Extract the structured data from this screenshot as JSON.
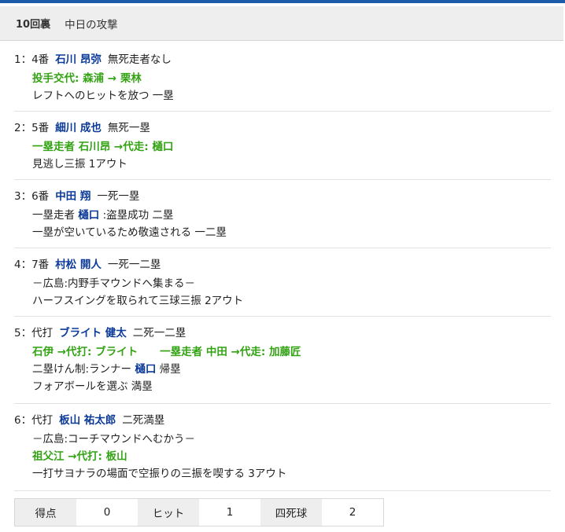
{
  "header": {
    "inning": "10回裏",
    "team_attack": "中日の攻撃"
  },
  "plays": [
    {
      "head": {
        "prefix": "1：4番",
        "batter": "石川 昂弥",
        "situation": "無死走者なし"
      },
      "lines": [
        {
          "segments": [
            {
              "t": "投手交代: ",
              "s": "green"
            },
            {
              "t": "森浦",
              "s": "green"
            },
            {
              "t": " → ",
              "s": "green"
            },
            {
              "t": "栗林",
              "s": "green"
            }
          ]
        },
        {
          "segments": [
            {
              "t": "レフトへのヒットを放つ 一塁",
              "s": ""
            }
          ]
        }
      ]
    },
    {
      "head": {
        "prefix": "2：5番",
        "batter": "細川 成也",
        "situation": "無死一塁"
      },
      "lines": [
        {
          "segments": [
            {
              "t": "一塁走者 ",
              "s": "green"
            },
            {
              "t": "石川昂",
              "s": "green"
            },
            {
              "t": " →代走: ",
              "s": "green"
            },
            {
              "t": "樋口",
              "s": "green"
            }
          ]
        },
        {
          "segments": [
            {
              "t": "見逃し三振 1アウト",
              "s": ""
            }
          ]
        }
      ]
    },
    {
      "head": {
        "prefix": "3：6番",
        "batter": "中田 翔",
        "situation": "一死一塁"
      },
      "lines": [
        {
          "segments": [
            {
              "t": "一塁走者 ",
              "s": ""
            },
            {
              "t": "樋口",
              "s": "blue"
            },
            {
              "t": " :盗塁成功 二塁",
              "s": ""
            }
          ]
        },
        {
          "segments": [
            {
              "t": "一塁が空いているため敬遠される 一二塁",
              "s": ""
            }
          ]
        }
      ]
    },
    {
      "head": {
        "prefix": "4：7番",
        "batter": "村松 開人",
        "situation": "一死一二塁"
      },
      "lines": [
        {
          "segments": [
            {
              "t": "－広島:内野手マウンドへ集まる－",
              "s": ""
            }
          ]
        },
        {
          "segments": [
            {
              "t": "ハーフスイングを取られて三球三振 2アウト",
              "s": ""
            }
          ]
        }
      ]
    },
    {
      "head": {
        "prefix": "5：代打",
        "batter": "ブライト 健太",
        "situation": "二死一二塁"
      },
      "lines": [
        {
          "segments": [
            {
              "t": "石伊",
              "s": "green"
            },
            {
              "t": " →代打: ",
              "s": "green"
            },
            {
              "t": "ブライト",
              "s": "green"
            },
            {
              "t": "一塁走者 ",
              "s": "green gap2"
            },
            {
              "t": "中田",
              "s": "green"
            },
            {
              "t": " →代走: ",
              "s": "green"
            },
            {
              "t": "加藤匠",
              "s": "green"
            }
          ]
        },
        {
          "segments": [
            {
              "t": "二塁けん制:ランナー ",
              "s": ""
            },
            {
              "t": "樋口",
              "s": "blue"
            },
            {
              "t": " 帰塁",
              "s": ""
            }
          ]
        },
        {
          "segments": [
            {
              "t": "フォアボールを選ぶ 満塁",
              "s": ""
            }
          ]
        }
      ]
    },
    {
      "head": {
        "prefix": "6：代打",
        "batter": "板山 祐太郎",
        "situation": "二死満塁"
      },
      "lines": [
        {
          "segments": [
            {
              "t": "－広島:コーチマウンドへむかう－",
              "s": ""
            }
          ]
        },
        {
          "segments": [
            {
              "t": "祖父江",
              "s": "green"
            },
            {
              "t": " →代打: ",
              "s": "green"
            },
            {
              "t": "板山",
              "s": "green"
            }
          ]
        },
        {
          "segments": [
            {
              "t": "一打サヨナラの場面で空振りの三振を喫する 3アウト",
              "s": ""
            }
          ]
        }
      ]
    }
  ],
  "stats": [
    {
      "label": "得点",
      "value": "0"
    },
    {
      "label": "ヒット",
      "value": "1"
    },
    {
      "label": "四死球",
      "value": "2"
    }
  ]
}
